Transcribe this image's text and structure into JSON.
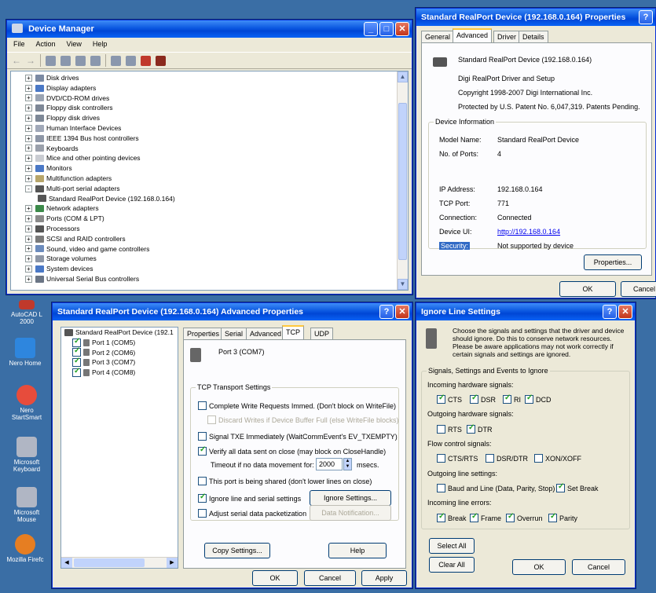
{
  "desktop": {
    "icons": [
      {
        "label": "AutoCAD L",
        "sub": "2000",
        "color": "#c0392b"
      },
      {
        "label": "Nero Home",
        "sub": "",
        "color": "#2e86de"
      },
      {
        "label": "Nero",
        "sub": "StartSmart",
        "color": "#e74c3c"
      },
      {
        "label": "Microsoft",
        "sub": "Keyboard",
        "color": "#b0b6c4"
      },
      {
        "label": "Microsoft",
        "sub": "Mouse",
        "color": "#b0b6c4"
      },
      {
        "label": "Mozilla Firefc",
        "sub": "",
        "color": "#e67e22"
      }
    ]
  },
  "device_manager": {
    "title": "Device Manager",
    "menu": [
      "File",
      "Action",
      "View",
      "Help"
    ],
    "tree": [
      {
        "label": "Disk drives",
        "exp": "+",
        "indent": 0,
        "color": "#7b8aa3"
      },
      {
        "label": "Display adapters",
        "exp": "+",
        "indent": 0,
        "color": "#4a78c6"
      },
      {
        "label": "DVD/CD-ROM drives",
        "exp": "+",
        "indent": 0,
        "color": "#9aa4b3"
      },
      {
        "label": "Floppy disk controllers",
        "exp": "+",
        "indent": 0,
        "color": "#7d8796"
      },
      {
        "label": "Floppy disk drives",
        "exp": "+",
        "indent": 0,
        "color": "#7d8796"
      },
      {
        "label": "Human Interface Devices",
        "exp": "+",
        "indent": 0,
        "color": "#a0a8b8"
      },
      {
        "label": "IEEE 1394 Bus host controllers",
        "exp": "+",
        "indent": 0,
        "color": "#8d96a6"
      },
      {
        "label": "Keyboards",
        "exp": "+",
        "indent": 0,
        "color": "#9aa0ab"
      },
      {
        "label": "Mice and other pointing devices",
        "exp": "+",
        "indent": 0,
        "color": "#c9ccd2"
      },
      {
        "label": "Monitors",
        "exp": "+",
        "indent": 0,
        "color": "#4a78c6"
      },
      {
        "label": "Multifunction adapters",
        "exp": "+",
        "indent": 0,
        "color": "#b7a56a"
      },
      {
        "label": "Multi-port serial adapters",
        "exp": "-",
        "indent": 0,
        "color": "#555"
      },
      {
        "label": "Standard RealPort Device (192.168.0.164)",
        "exp": "",
        "indent": 1,
        "color": "#555"
      },
      {
        "label": "Network adapters",
        "exp": "+",
        "indent": 0,
        "color": "#3c8a4a"
      },
      {
        "label": "Ports (COM & LPT)",
        "exp": "+",
        "indent": 0,
        "color": "#8a8a8a"
      },
      {
        "label": "Processors",
        "exp": "+",
        "indent": 0,
        "color": "#555"
      },
      {
        "label": "SCSI and RAID controllers",
        "exp": "+",
        "indent": 0,
        "color": "#7a7a7a"
      },
      {
        "label": "Sound, video and game controllers",
        "exp": "+",
        "indent": 0,
        "color": "#6b8bbd"
      },
      {
        "label": "Storage volumes",
        "exp": "+",
        "indent": 0,
        "color": "#8d96a6"
      },
      {
        "label": "System devices",
        "exp": "+",
        "indent": 0,
        "color": "#4a78c6"
      },
      {
        "label": "Universal Serial Bus controllers",
        "exp": "+",
        "indent": 0,
        "color": "#6b7585"
      }
    ]
  },
  "properties": {
    "title": "Standard RealPort Device (192.168.0.164) Properties",
    "tabs": [
      "General",
      "Advanced",
      "Driver",
      "Details"
    ],
    "device_name": "Standard RealPort Device (192.168.0.164)",
    "driver_line": "Digi RealPort Driver and Setup",
    "copyright": "Copyright 1998-2007 Digi International Inc.",
    "patent": "Protected by U.S. Patent No. 6,047,319. Patents Pending.",
    "info_legend": "Device Information",
    "model_label": "Model Name:",
    "model_value": "Standard RealPort Device",
    "ports_label": "No. of Ports:",
    "ports_value": "4",
    "ip_label": "IP Address:",
    "ip_value": "192.168.0.164",
    "tcp_label": "TCP Port:",
    "tcp_value": "771",
    "conn_label": "Connection:",
    "conn_value": "Connected",
    "ui_label": "Device UI:",
    "ui_value": "http://192.168.0.164",
    "sec_label": "Security:",
    "sec_value": "Not supported by device",
    "properties_button": "Properties...",
    "ok": "OK",
    "cancel": "Cancel"
  },
  "advanced": {
    "title": "Standard RealPort Device (192.168.0.164) Advanced Properties",
    "tree_root": "Standard RealPort Device (192.1",
    "ports": [
      "Port 1 (COM5)",
      "Port 2 (COM6)",
      "Port 3 (COM7)",
      "Port 4 (COM8)"
    ],
    "tabs": [
      "Properties",
      "Serial",
      "Advanced",
      "TCP",
      "UDP"
    ],
    "port_header": "Port 3 (COM7)",
    "group_legend": "TCP Transport Settings",
    "opt_complete_write": "Complete Write Requests Immed. (Don't block on WriteFile)",
    "opt_discard": "Discard Writes if Device Buffer Full (else WriteFile blocks)",
    "opt_signal_txe": "Signal TXE Immediately (WaitCommEvent's EV_TXEMPTY)",
    "opt_verify": "Verify all data sent on close (may block on CloseHandle)",
    "timeout_label": "Timeout if no data movement for:",
    "timeout_value": "2000",
    "timeout_unit": "msecs.",
    "opt_shared": "This port is being shared (don't lower lines on close)",
    "opt_ignore": "Ignore line and serial settings",
    "ignore_settings_button": "Ignore Settings...",
    "opt_adjust": "Adjust serial data packetization",
    "data_notification_button": "Data Notification...",
    "copy_settings": "Copy Settings...",
    "help": "Help",
    "ok": "OK",
    "cancel": "Cancel",
    "apply": "Apply"
  },
  "ignore": {
    "title": "Ignore Line Settings",
    "description": "Choose the signals and settings that the driver and device should ignore. Do this to conserve network resources. Please be aware applications may not work correctly if certain signals and settings are ignored.",
    "group_legend": "Signals, Settings and Events to Ignore",
    "incoming_hw": "Incoming hardware signals:",
    "cts": "CTS",
    "dsr": "DSR",
    "ri": "RI",
    "dcd": "DCD",
    "outgoing_hw": "Outgoing hardware signals:",
    "rts": "RTS",
    "dtr": "DTR",
    "flow": "Flow control signals:",
    "ctsrts": "CTS/RTS",
    "dsrdtr": "DSR/DTR",
    "xonxoff": "XON/XOFF",
    "outgoing_line": "Outgoing line settings:",
    "baud": "Baud and Line (Data, Parity, Stop)",
    "set_break": "Set Break",
    "incoming_err": "Incoming line errors:",
    "break": "Break",
    "frame": "Frame",
    "overrun": "Overrun",
    "parity": "Parity",
    "select_all": "Select All",
    "clear_all": "Clear All",
    "ok": "OK",
    "cancel": "Cancel"
  }
}
